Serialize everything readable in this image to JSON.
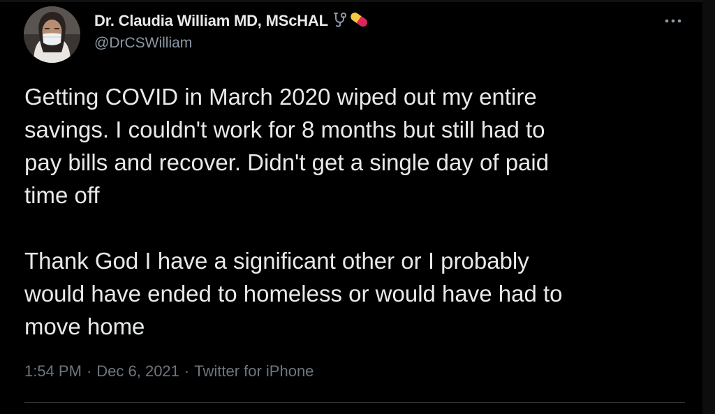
{
  "author": {
    "display_name": "Dr. Claudia William MD, MScHAL",
    "handle": "@DrCSWilliam",
    "name_emoji": [
      "stethoscope-icon",
      "pill-icon"
    ]
  },
  "tweet": {
    "paragraphs": [
      "Getting COVID in March 2020 wiped out my entire\nsavings. I couldn't work for 8 months but still had to\npay bills and recover. Didn't get a single day of paid\ntime off",
      "Thank God I have a significant other or I probably\nwould have ended to homeless or would have had to\nmove home"
    ]
  },
  "meta": {
    "time": "1:54 PM",
    "separator": "·",
    "date": "Dec 6, 2021",
    "source": "Twitter for iPhone"
  },
  "colors": {
    "background": "#000000",
    "text_primary": "#e7e9ea",
    "text_secondary": "#6e767d",
    "divider": "#2f3336"
  }
}
